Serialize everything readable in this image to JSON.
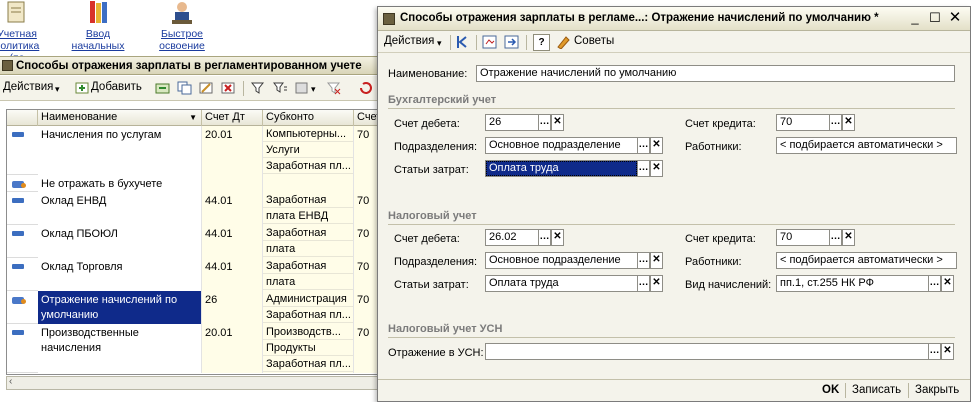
{
  "top_buttons": [
    {
      "label1": "Учетная",
      "label2": "политика (по"
    },
    {
      "label1": "Ввод",
      "label2": "начальных"
    },
    {
      "label1": "Быстрое",
      "label2": "освоение"
    }
  ],
  "left_window": {
    "title": "Способы отражения зарплаты в регламентированном учете",
    "toolbar": {
      "actions": "Действия",
      "add": "Добавить"
    },
    "columns": [
      "Наименование",
      "Счет Дт",
      "Субконто",
      "Счет"
    ],
    "rows": [
      {
        "name": "Начисления по услугам",
        "debit": "20.01",
        "subconto": [
          "Компьютерны...",
          "Услуги",
          "Заработная пл..."
        ],
        "credit": "70"
      },
      {
        "name": "Не отражать в бухучете",
        "debit": "",
        "subconto": [],
        "credit": ""
      },
      {
        "name": "Оклад ЕНВД",
        "debit": "44.01",
        "subconto": [
          "Заработная",
          "плата ЕНВД"
        ],
        "credit": "70"
      },
      {
        "name": "Оклад ПБОЮЛ",
        "debit": "44.01",
        "subconto": [
          "Заработная",
          "плата"
        ],
        "credit": "70"
      },
      {
        "name": "Оклад Торговля",
        "debit": "44.01",
        "subconto": [
          "Заработная",
          "плата"
        ],
        "credit": "70"
      },
      {
        "name": "Отражение начислений по умолчанию",
        "debit": "26",
        "subconto": [
          "Администрация",
          "Заработная пл..."
        ],
        "credit": "70"
      },
      {
        "name": "Производственные начисления",
        "debit": "20.01",
        "subconto": [
          "Производств...",
          "Продукты",
          "Заработная пл..."
        ],
        "credit": "70"
      }
    ]
  },
  "dialog": {
    "title": "Способы отражения зарплаты в регламе...: Отражение начислений по умолчанию *",
    "toolbar": {
      "actions": "Действия",
      "tips": "Советы"
    },
    "name_label": "Наименование:",
    "name_value": "Отражение начислений по умолчанию",
    "accounting": {
      "header": "Бухгалтерский учет",
      "debit_label": "Счет дебета:",
      "debit_value": "26",
      "credit_label": "Счет кредита:",
      "credit_value": "70",
      "dept_label": "Подразделения:",
      "dept_value": "Основное подразделение",
      "workers_label": "Работники:",
      "workers_value": "< подбирается автоматически >",
      "cost_label": "Статьи затрат:",
      "cost_value": "Оплата труда"
    },
    "tax": {
      "header": "Налоговый учет",
      "debit_label": "Счет дебета:",
      "debit_value": "26.02",
      "credit_label": "Счет кредита:",
      "credit_value": "70",
      "dept_label": "Подразделения:",
      "dept_value": "Основное подразделение",
      "workers_label": "Работники:",
      "workers_value": "< подбирается автоматически >",
      "cost_label": "Статьи затрат:",
      "cost_value": "Оплата труда",
      "kind_label": "Вид начислений:",
      "kind_value": "пп.1, ст.255 НК РФ"
    },
    "usn": {
      "header": "Налоговый учет УСН",
      "label": "Отражение в УСН:",
      "value": ""
    },
    "buttons": {
      "ok": "OK",
      "save": "Записать",
      "close": "Закрыть"
    }
  },
  "colors": {
    "selection": "#0f2a8a",
    "header_text": "#7b7b7b",
    "link": "#1a3b9e"
  }
}
